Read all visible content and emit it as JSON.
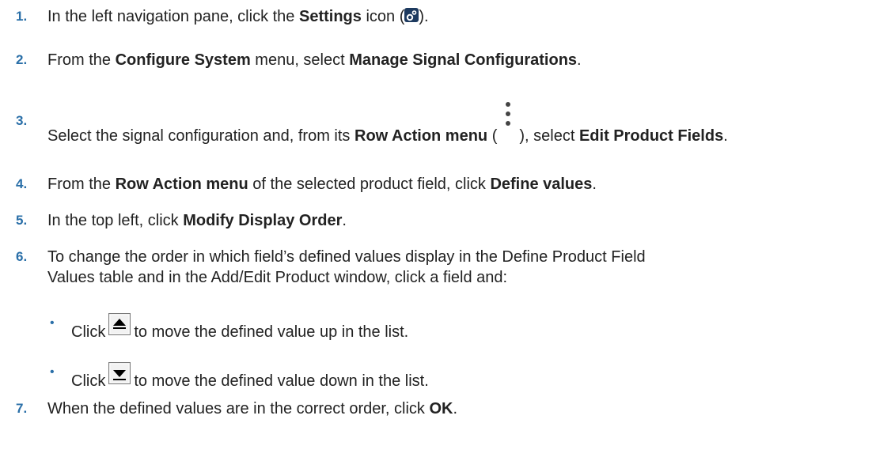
{
  "steps": [
    {
      "number": "1.",
      "parts": [
        "In the left navigation pane, click the ",
        "Settings",
        " icon (",
        ")."
      ]
    },
    {
      "number": "2.",
      "parts": [
        "From the ",
        "Configure System",
        " menu, select ",
        "Manage Signal Configurations",
        "."
      ]
    },
    {
      "number": "3.",
      "parts": [
        "Select the signal configuration and, from its ",
        "Row Action menu",
        " (",
        "), select ",
        "Edit Product Fields",
        "."
      ]
    },
    {
      "number": "4.",
      "parts": [
        "From the ",
        "Row Action menu",
        " of the selected product field, click ",
        "Define values",
        "."
      ]
    },
    {
      "number": "5.",
      "parts": [
        "In the top left, click ",
        "Modify Display Order",
        "."
      ]
    },
    {
      "number": "6.",
      "line1": "To change the order in which field’s defined values display in the Define Product Field",
      "line2": "Values table and in the Add/Edit Product window, click a field and:"
    },
    {
      "number": "7.",
      "parts": [
        "When the defined values are in the correct order, click ",
        "OK",
        "."
      ]
    }
  ],
  "bullets": [
    {
      "marker": "•",
      "before": "Click",
      "after": "to move the defined value up in the list."
    },
    {
      "marker": "•",
      "before": "Click",
      "after": "to move the defined value down in the list."
    }
  ],
  "icons": {
    "settings": "settings-gear-icon",
    "row_action": "kebab-menu-icon",
    "move_up": "move-up-arrow-icon",
    "move_down": "move-down-arrow-icon"
  },
  "colors": {
    "step_number": "#2a6fa8",
    "text": "#222222",
    "settings_icon_bg": "#1d3a5f"
  }
}
